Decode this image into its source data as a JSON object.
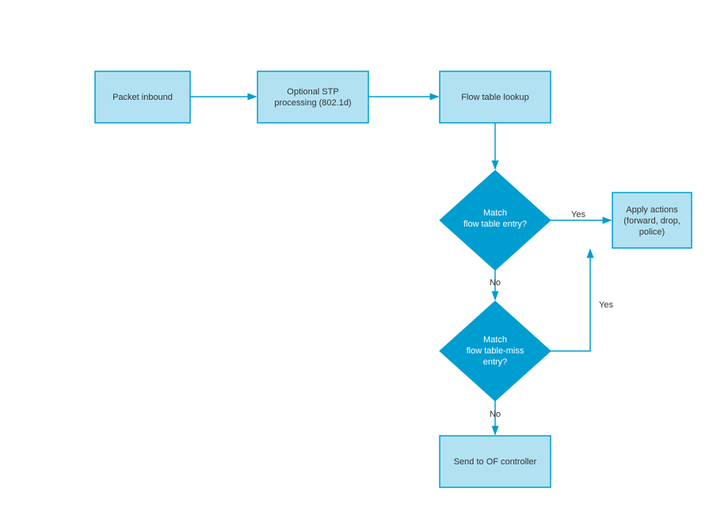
{
  "chart_data": {
    "type": "flowchart",
    "nodes": [
      {
        "id": "n1",
        "type": "process",
        "label": "Packet inbound"
      },
      {
        "id": "n2",
        "type": "process",
        "label": "Optional STP processing (802.1d)"
      },
      {
        "id": "n3",
        "type": "process",
        "label": "Flow table lookup"
      },
      {
        "id": "d1",
        "type": "decision",
        "label": "Match flow table entry?"
      },
      {
        "id": "d2",
        "type": "decision",
        "label": "Match flow table-miss entry?"
      },
      {
        "id": "n4",
        "type": "process",
        "label": "Apply actions (forward, drop, police)"
      },
      {
        "id": "n5",
        "type": "process",
        "label": "Send to OF controller"
      }
    ],
    "edges": [
      {
        "from": "n1",
        "to": "n2",
        "label": ""
      },
      {
        "from": "n2",
        "to": "n3",
        "label": ""
      },
      {
        "from": "n3",
        "to": "d1",
        "label": ""
      },
      {
        "from": "d1",
        "to": "n4",
        "label": "Yes"
      },
      {
        "from": "d1",
        "to": "d2",
        "label": "No"
      },
      {
        "from": "d2",
        "to": "n4",
        "label": "Yes"
      },
      {
        "from": "d2",
        "to": "n5",
        "label": "No"
      }
    ]
  },
  "nodes": {
    "n1": {
      "line1": "Packet inbound"
    },
    "n2": {
      "line1": "Optional STP",
      "line2": "processing (802.1d)"
    },
    "n3": {
      "line1": "Flow table lookup"
    },
    "d1": {
      "line1": "Match",
      "line2": "flow table entry?"
    },
    "d2": {
      "line1": "Match",
      "line2": "flow table-miss",
      "line3": "entry?"
    },
    "n4": {
      "line1": "Apply actions",
      "line2": "(forward, drop,",
      "line3": "police)"
    },
    "n5": {
      "line1": "Send to OF controller"
    }
  },
  "edges": {
    "d1_yes": "Yes",
    "d1_no": "No",
    "d2_yes": "Yes",
    "d2_no": "No"
  }
}
